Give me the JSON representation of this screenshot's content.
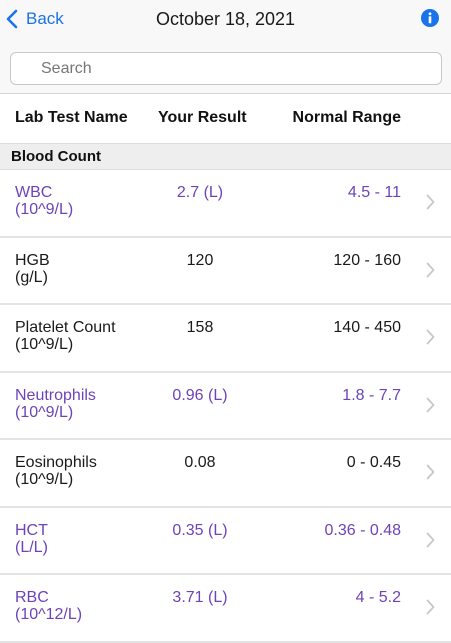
{
  "nav": {
    "back_label": "Back",
    "title": "October 18, 2021",
    "accent": "#1a73e8"
  },
  "search": {
    "placeholder": "Search"
  },
  "columns": {
    "name": "Lab Test Name",
    "result": "Your Result",
    "range": "Normal Range"
  },
  "section": {
    "title": "Blood Count"
  },
  "colors": {
    "flagged": "#6d43b7",
    "normal": "#1a1a1a"
  },
  "rows": [
    {
      "name": "WBC",
      "unit": "(10^9/L)",
      "result": "2.7 (L)",
      "range": "4.5 - 11",
      "flagged": true
    },
    {
      "name": "HGB",
      "unit": "(g/L)",
      "result": "120",
      "range": "120 - 160",
      "flagged": false
    },
    {
      "name": "Platelet Count",
      "unit": "(10^9/L)",
      "result": "158",
      "range": "140 - 450",
      "flagged": false
    },
    {
      "name": "Neutrophils",
      "unit": "(10^9/L)",
      "result": "0.96 (L)",
      "range": "1.8 - 7.7",
      "flagged": true
    },
    {
      "name": "Eosinophils",
      "unit": "(10^9/L)",
      "result": "0.08",
      "range": "0 - 0.45",
      "flagged": false
    },
    {
      "name": "HCT",
      "unit": "(L/L)",
      "result": "0.35 (L)",
      "range": "0.36 - 0.48",
      "flagged": true
    },
    {
      "name": "RBC",
      "unit": "(10^12/L)",
      "result": "3.71 (L)",
      "range": "4 - 5.2",
      "flagged": true
    }
  ]
}
